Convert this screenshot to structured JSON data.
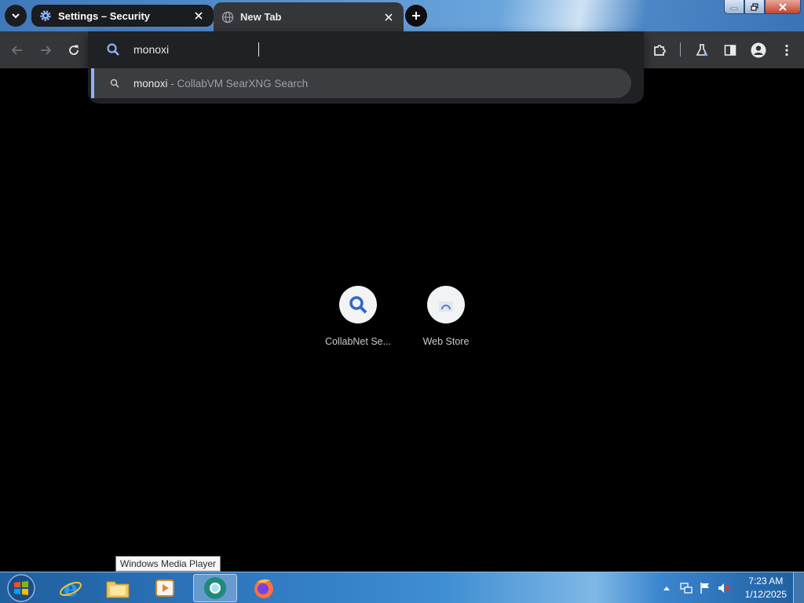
{
  "browser": {
    "tabs": [
      {
        "title": "Settings – Security",
        "active": false,
        "icon": "gear-icon"
      },
      {
        "title": "New Tab",
        "active": true,
        "icon": "globe-icon"
      }
    ]
  },
  "omnibox": {
    "value": "monoxi",
    "suggestion": {
      "query": "monoxi",
      "separator": " - ",
      "description": "CollabVM SearXNG Search"
    }
  },
  "shortcuts": [
    {
      "label": "CollabNet Se...",
      "icon": "search-icon"
    },
    {
      "label": "Web Store",
      "icon": "web-store-icon"
    }
  ],
  "tooltip": "Windows Media Player",
  "taskbar": {
    "apps": [
      "internet-explorer",
      "file-explorer",
      "windows-media-player",
      "chromium",
      "firefox"
    ],
    "active_app": "chromium",
    "clock_time": "7:23 AM",
    "clock_date": "1/12/2025"
  },
  "colors": {
    "accent": "#8ab4f8",
    "toolbar": "#35363a",
    "popup": "#202124"
  }
}
